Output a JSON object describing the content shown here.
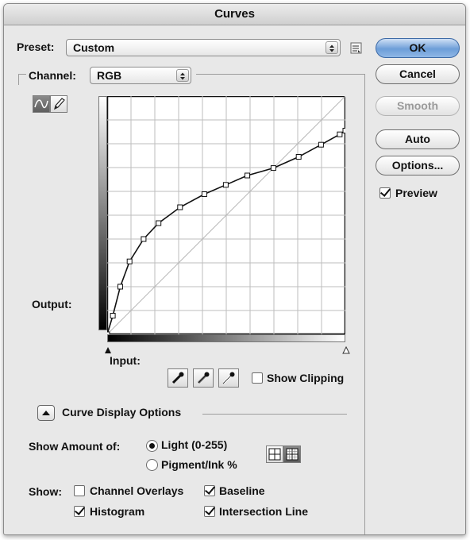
{
  "window": {
    "title": "Curves"
  },
  "preset": {
    "label": "Preset:",
    "value": "Custom"
  },
  "channel": {
    "label": "Channel:",
    "value": "RGB"
  },
  "buttons": {
    "ok": "OK",
    "cancel": "Cancel",
    "smooth": "Smooth",
    "auto": "Auto",
    "options": "Options..."
  },
  "preview": {
    "label": "Preview",
    "checked": true
  },
  "graph": {
    "output_label": "Output:",
    "input_label": "Input:",
    "grid_divisions": 10,
    "curve_points": [
      [
        0,
        0
      ],
      [
        6,
        20
      ],
      [
        14,
        51
      ],
      [
        24,
        78
      ],
      [
        39,
        102
      ],
      [
        55,
        119
      ],
      [
        78,
        136
      ],
      [
        104,
        150
      ],
      [
        127,
        160
      ],
      [
        150,
        170
      ],
      [
        178,
        178
      ],
      [
        205,
        190
      ],
      [
        229,
        203
      ],
      [
        249,
        214
      ],
      [
        255,
        218
      ]
    ],
    "baseline": true
  },
  "eyedroppers": [
    "black-point-eyedropper",
    "gray-point-eyedropper",
    "white-point-eyedropper"
  ],
  "show_clipping": {
    "label": "Show Clipping",
    "checked": false
  },
  "display_options": {
    "title": "Curve Display Options",
    "show_amount_label": "Show Amount of:",
    "light_label": "Light  (0-255)",
    "light_selected": true,
    "pigment_label": "Pigment/Ink %",
    "show_label": "Show:",
    "channel_overlays": {
      "label": "Channel Overlays",
      "checked": false
    },
    "baseline": {
      "label": "Baseline",
      "checked": true
    },
    "histogram": {
      "label": "Histogram",
      "checked": true
    },
    "intersection_line": {
      "label": "Intersection Line",
      "checked": true
    }
  }
}
